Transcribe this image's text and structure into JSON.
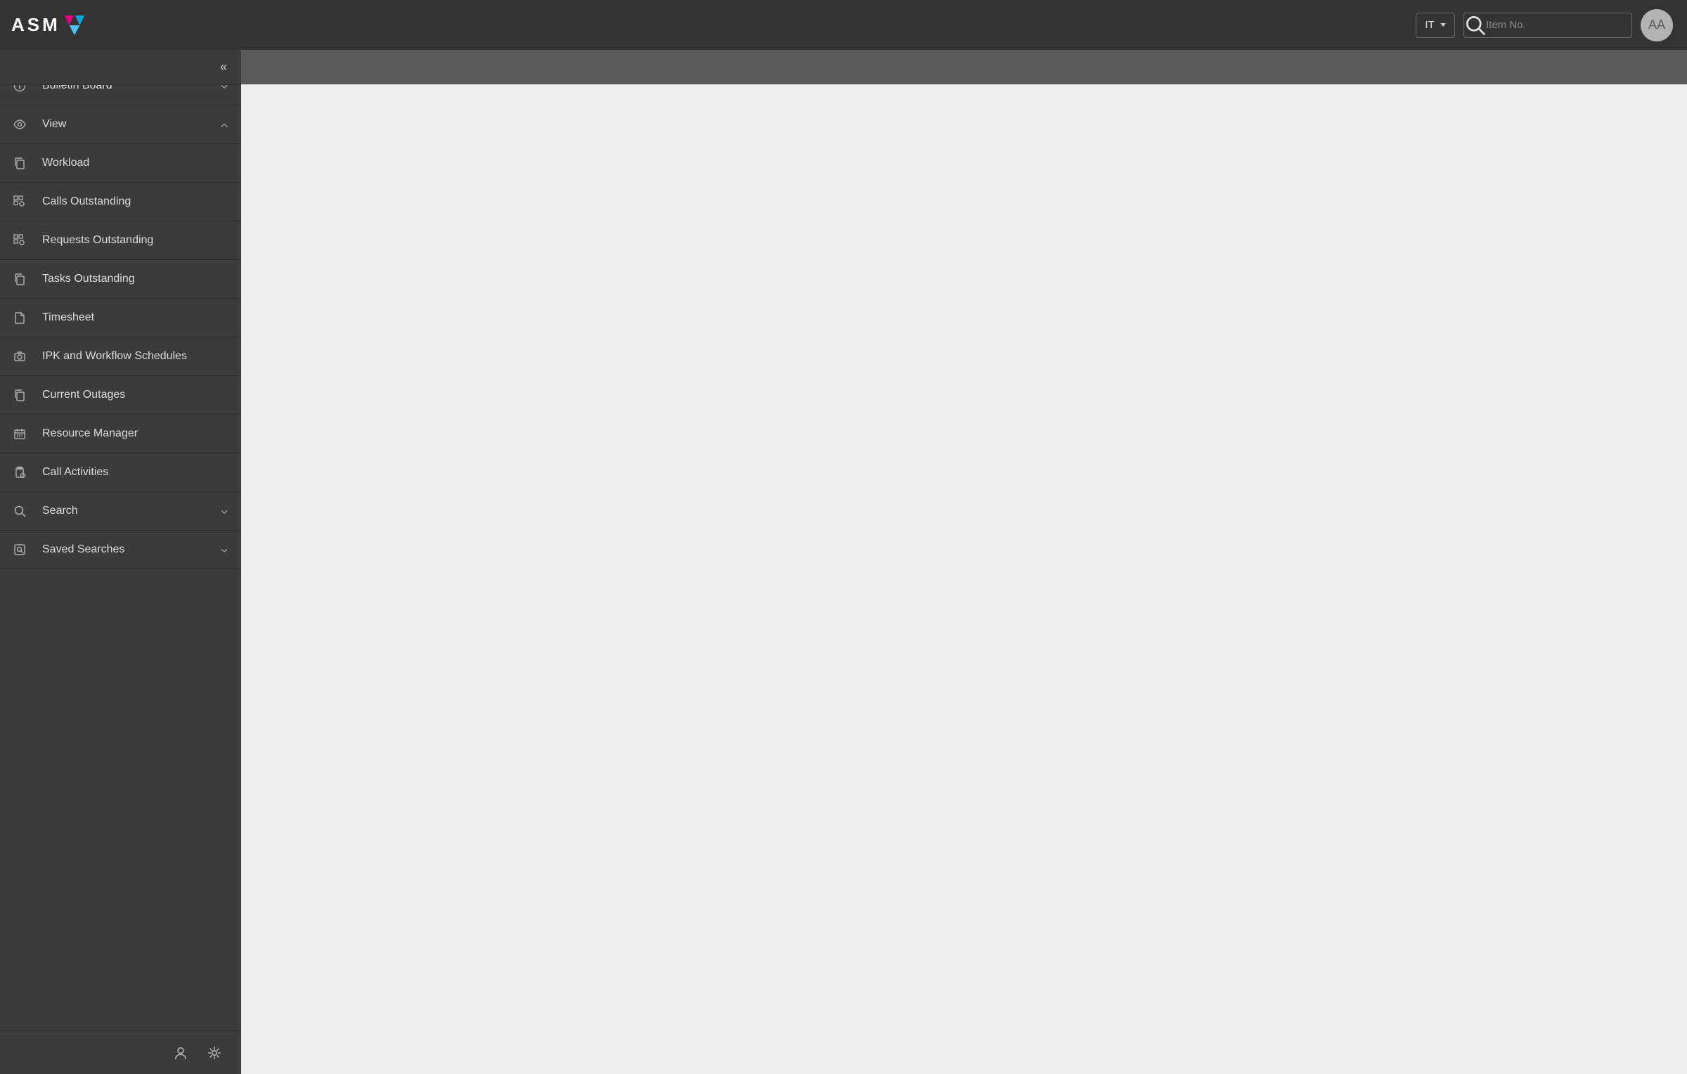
{
  "header": {
    "brand_text": "ASM",
    "tenant_label": "IT",
    "search_placeholder": "Item No.",
    "avatar_initials": "AA"
  },
  "sidebar": {
    "collapse_glyph": "«",
    "items": [
      {
        "id": "bulletin-board",
        "label": "Bulletin Board",
        "icon": "info",
        "expandable": true,
        "expanded": false
      },
      {
        "id": "view",
        "label": "View",
        "icon": "eye",
        "expandable": true,
        "expanded": true
      },
      {
        "id": "workload",
        "label": "Workload",
        "icon": "copy",
        "expandable": false
      },
      {
        "id": "calls-outstanding",
        "label": "Calls Outstanding",
        "icon": "grid-gear",
        "expandable": false
      },
      {
        "id": "requests-outstanding",
        "label": "Requests Outstanding",
        "icon": "grid-gear",
        "expandable": false
      },
      {
        "id": "tasks-outstanding",
        "label": "Tasks Outstanding",
        "icon": "copy",
        "expandable": false
      },
      {
        "id": "timesheet",
        "label": "Timesheet",
        "icon": "file",
        "expandable": false
      },
      {
        "id": "ipk-workflow-schedules",
        "label": "IPK and Workflow Schedules",
        "icon": "camera",
        "expandable": false
      },
      {
        "id": "current-outages",
        "label": "Current Outages",
        "icon": "copy",
        "expandable": false
      },
      {
        "id": "resource-manager",
        "label": "Resource Manager",
        "icon": "calendar",
        "expandable": false
      },
      {
        "id": "call-activities",
        "label": "Call Activities",
        "icon": "clipboard",
        "expandable": false
      },
      {
        "id": "search",
        "label": "Search",
        "icon": "search",
        "expandable": true,
        "expanded": false
      },
      {
        "id": "saved-searches",
        "label": "Saved Searches",
        "icon": "search-square",
        "expandable": true,
        "expanded": false
      }
    ]
  }
}
